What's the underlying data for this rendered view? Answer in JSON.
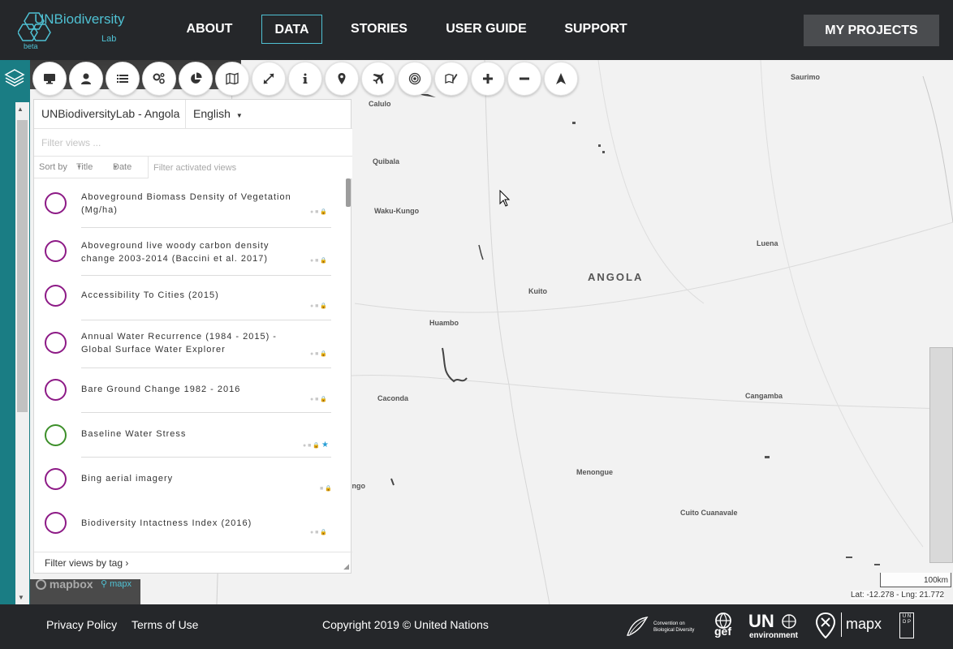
{
  "header": {
    "logo": {
      "name": "UNBiodiversity",
      "sub": "Lab",
      "beta": "beta"
    },
    "nav": [
      "ABOUT",
      "DATA",
      "STORIES",
      "USER GUIDE",
      "SUPPORT"
    ],
    "active_nav": "DATA",
    "my_projects": "MY PROJECTS"
  },
  "toolbar": {
    "buttons": [
      "desktop-icon",
      "user-icon",
      "list-icon",
      "cogs-icon",
      "pie-chart-icon",
      "map-icon",
      "expand-icon",
      "info-icon",
      "map-pin-icon",
      "plane-icon",
      "target-icon",
      "map-edit-icon",
      "plus-icon",
      "minus-icon",
      "compass-arrow-icon"
    ]
  },
  "panel": {
    "project": "UNBiodiversityLab - Angola",
    "language": "English",
    "filter_placeholder": "Filter views ...",
    "sort_by": "Sort by",
    "sort_title": "Title",
    "sort_date": "Date",
    "filter_activated_placeholder": "Filter activated views",
    "views": [
      {
        "title": "Aboveground Biomass Density of Vegetation (Mg/ha)",
        "color": "#8d1a86"
      },
      {
        "title": "Aboveground live woody carbon density change 2003-2014 (Baccini et al. 2017)",
        "color": "#8d1a86"
      },
      {
        "title": "Accessibility To Cities (2015)",
        "color": "#8d1a86"
      },
      {
        "title": "Annual Water Recurrence (1984 - 2015) - Global Surface Water Explorer",
        "color": "#8d1a86"
      },
      {
        "title": "Bare Ground Change 1982 - 2016",
        "color": "#8d1a86"
      },
      {
        "title": "Baseline Water Stress",
        "color": "#3d8f2a"
      },
      {
        "title": "Bing aerial imagery",
        "color": "#8d1a86"
      },
      {
        "title": "Biodiversity Intactness Index (2016)",
        "color": "#8d1a86"
      }
    ],
    "footer": "Filter views by tag ›"
  },
  "map": {
    "country": "ANGOLA",
    "places": [
      "Calulo",
      "Quibala",
      "Waku-Kungo",
      "Kuito",
      "Huambo",
      "Caconda",
      "Saurimo",
      "Luena",
      "Cangamba",
      "Menongue",
      "Cuito Cuanavale",
      "ungo"
    ],
    "scale": "100km",
    "coords": "Lat: -12.278 - Lng: 21.772",
    "mapbox": "mapbox",
    "mapx": "mapx"
  },
  "footer": {
    "privacy": "Privacy Policy",
    "terms": "Terms of Use",
    "copyright": "Copyright 2019 © United Nations",
    "partners": {
      "cbd_line1": "Convention on",
      "cbd_line2": "Biological Diversity",
      "gef": "gef",
      "un": "UN",
      "un_sub": "environment",
      "mapx": "mapx",
      "undp": "U N D P"
    }
  }
}
